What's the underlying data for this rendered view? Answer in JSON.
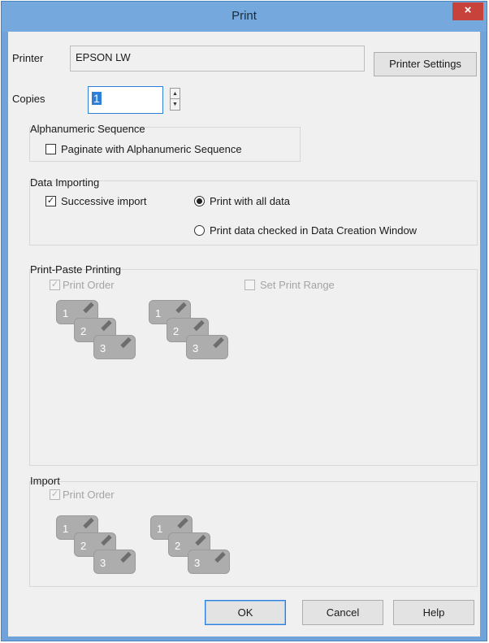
{
  "window": {
    "title": "Print",
    "close_glyph": "×"
  },
  "printer": {
    "label": "Printer",
    "value": "EPSON LW",
    "settings_button": "Printer Settings"
  },
  "copies": {
    "label": "Copies",
    "value": "1"
  },
  "alphanumeric": {
    "title": "Alphanumeric Sequence",
    "paginate_label": "Paginate with Alphanumeric Sequence",
    "paginate_checked": false
  },
  "data_importing": {
    "title": "Data Importing",
    "successive_label": "Successive import",
    "successive_checked": true,
    "radio_all_label": "Print with all data",
    "radio_checked_label": "Print data checked in Data Creation Window",
    "selected": "all"
  },
  "print_paste": {
    "title": "Print-Paste Printing",
    "print_order_label": "Print Order",
    "print_order_checked": true,
    "set_range_label": "Set Print Range",
    "set_range_checked": false,
    "card_numbers": [
      "1",
      "2",
      "3"
    ]
  },
  "import": {
    "title": "Import",
    "print_order_label": "Print Order",
    "print_order_checked": true,
    "card_numbers": [
      "1",
      "2",
      "3"
    ]
  },
  "buttons": {
    "ok": "OK",
    "cancel": "Cancel",
    "help": "Help"
  },
  "icons": {
    "close": "close-icon",
    "spin_up": "spin-up-icon",
    "spin_down": "spin-down-icon",
    "check": "checkmark-icon"
  },
  "colors": {
    "titlebar": "#75a8dc",
    "close": "#c7423a",
    "accent": "#2f7fd6",
    "dialog_bg": "#f0f0f0"
  }
}
